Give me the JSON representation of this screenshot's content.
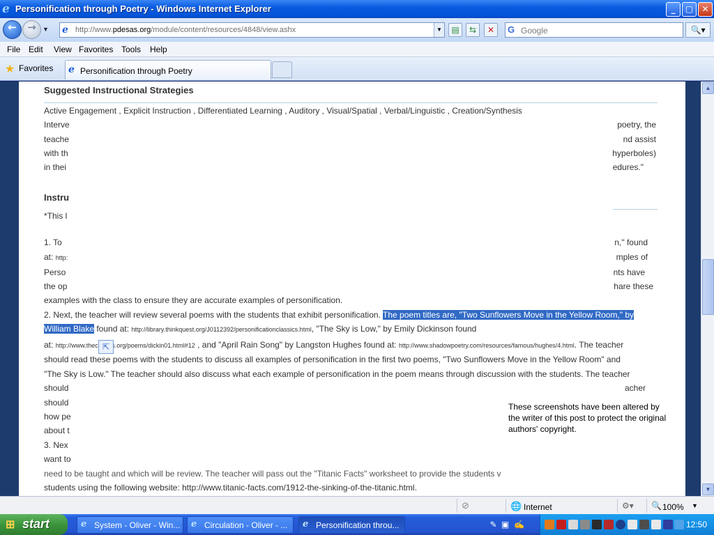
{
  "window": {
    "title": "Personification through Poetry - Windows Internet Explorer",
    "buttons": [
      "_",
      "▢",
      "✕"
    ]
  },
  "address_bar": {
    "url_prefix": "http://www.",
    "url_domain": "pdesas.org",
    "url_path": "/module/content/resources/4848/view.ashx",
    "search_placeholder": "Google"
  },
  "menu": [
    "File",
    "Edit",
    "View",
    "Favorites",
    "Tools",
    "Help"
  ],
  "favorites_bar": {
    "label": "Favorites"
  },
  "tab": {
    "label": "Personification through Poetry"
  },
  "page": {
    "heading1": "Suggested Instructional Strategies",
    "strategies": "Active Engagement , Explicit Instruction , Differentiated Learning , Auditory , Visual/Spatial , Verbal/Linguistic , Creation/Synthesis",
    "l_interve": "Interve",
    "r_poetry": "poetry, the",
    "l_teache": "teache",
    "r_assist": "nd assist",
    "l_with": "with th",
    "r_hyper": "hyperboles)",
    "l_inthe": "in thei",
    "r_edures": "edures.\"",
    "heading2": "Instru",
    "l_this": "*This l",
    "l_one": "1.  To",
    "r_found": "n,\" found",
    "l_at": "at:",
    "l_at_link": "http:",
    "r_mples": "mples of",
    "l_perso": "Perso",
    "r_nts": "nts have",
    "l_op": "the op",
    "r_share": "hare these",
    "line_examples": "examples with the class to ensure they are accurate examples of personification.",
    "line2_a": "2. Next, the teacher will review several poems with the students that exhibit personification.  ",
    "line2_hl": "The poem titles are, \"Two Sunflowers Move in the Yellow Room,\" by",
    "line3_hl": "William Blake",
    "line3_b": " found at: ",
    "line3_link": "http://library.thinkquest.org/J0112392/personificationclassics.html",
    "line3_c": ", \"The Sky is Low,\" by Emily Dickinson found",
    "line4_a": "at: ",
    "line4_link1": "http://www.theci   ages.org/poems/dickin01.html#12",
    "line4_b": " , and \"April Rain Song\" by Langston Hughes found at: ",
    "line4_link2": "http://www.shadowpoetry.com/resources/famous/hughes/4.html",
    "line4_c": ". The teacher",
    "line5": "should read these poems with the students to discuss all examples of personification in the first two poems, \"Two Sunflowers Move in the Yellow Room\" and",
    "line6": "\"The Sky is Low.\"  The teacher should also discuss what each example of personification in the poem means through discussion with the students.  The teacher",
    "l_should1": "should",
    "r_acher": "acher",
    "l_should2": "should",
    "l_howpe": "how pe",
    "l_about": "about t",
    "l_three": " 3.  Nex",
    "l_want": "want to",
    "line_need": "need to be taught and which will be review. The teacher will pass out the \"Titanic Facts\" worksheet to provide the students v",
    "line_students": "students using the following website: http://www.titanic-facts.com/1912-the-sinking-of-the-titanic.html.",
    "notice": "These screenshots have been altered by the writer of this post to protect the original authors' copyright."
  },
  "status_bar": {
    "zone": "Internet",
    "zoom": "100%"
  },
  "taskbar": {
    "start": "start",
    "tasks": [
      "System - Oliver - Win...",
      "Circulation - Oliver - ...",
      "Personification throu..."
    ],
    "clock": "12:50"
  }
}
